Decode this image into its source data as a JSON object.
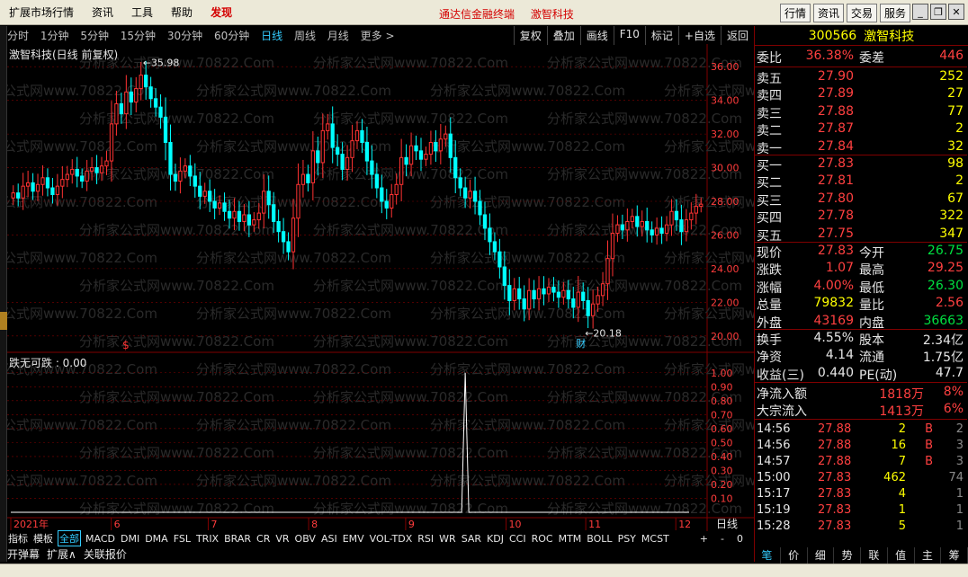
{
  "topbar": {
    "menu": [
      "扩展市场行情",
      "资讯",
      "工具",
      "帮助",
      "发现"
    ],
    "center": [
      "通达信金融终端",
      "激智科技"
    ],
    "right_buttons": [
      "行情",
      "资讯",
      "交易",
      "服务"
    ]
  },
  "periodbar": {
    "periods": [
      "分时",
      "1分钟",
      "5分钟",
      "15分钟",
      "30分钟",
      "60分钟",
      "日线",
      "周线",
      "月线",
      "更多 >"
    ],
    "active": "日线",
    "tools": [
      "复权",
      "叠加",
      "画线",
      "F10",
      "标记",
      "+自选",
      "返回"
    ]
  },
  "chart": {
    "title": "激智科技(日线 前复权)",
    "max_label": "35.98",
    "min_label": "20.18",
    "cai_marker": "财",
    "s_marker": "$",
    "indicator_title": "跌无可跌 : 0.00",
    "watermark": "分析家公式网www.70822.Com",
    "date_labels": [
      "2021年",
      "6",
      "7",
      "8",
      "9",
      "10",
      "11",
      "12"
    ],
    "period_box": "日线",
    "scroll_controls": [
      "+",
      "-",
      "0"
    ]
  },
  "chart_data": {
    "type": "candlestick",
    "title": "激智科技(日线 前复权)",
    "y_ticks_price": [
      20.0,
      22.0,
      24.0,
      26.0,
      28.0,
      30.0,
      32.0,
      34.0,
      36.0
    ],
    "price_ylim": [
      19.4,
      36.6
    ],
    "y_ticks_indicator": [
      0.1,
      0.2,
      0.3,
      0.4,
      0.5,
      0.6,
      0.7,
      0.8,
      0.9,
      1.0
    ],
    "indicator_ylim": [
      0,
      1.05
    ],
    "x_labels": [
      "2021年",
      "6",
      "7",
      "8",
      "9",
      "10",
      "11",
      "12"
    ],
    "closes": [
      28.5,
      28.2,
      28.9,
      29.1,
      28.6,
      29.0,
      29.4,
      28.8,
      28.4,
      28.9,
      29.3,
      29.6,
      29.9,
      29.5,
      29.2,
      29.8,
      30.0,
      29.7,
      30.1,
      30.4,
      32.6,
      33.8,
      33.2,
      34.5,
      33.9,
      34.7,
      35.5,
      34.8,
      34.1,
      33.6,
      33.0,
      31.5,
      29.6,
      29.2,
      29.8,
      30.1,
      29.5,
      28.9,
      28.3,
      28.6,
      28.0,
      27.6,
      27.9,
      27.4,
      27.0,
      27.4,
      26.8,
      27.2,
      26.6,
      26.9,
      27.3,
      28.6,
      27.8,
      26.8,
      26.2,
      25.6,
      25.0,
      27.0,
      29.0,
      29.6,
      29.1,
      31.0,
      30.3,
      32.2,
      32.6,
      31.2,
      30.8,
      29.9,
      30.6,
      31.6,
      32.2,
      31.5,
      30.4,
      29.6,
      28.8,
      28.0,
      27.6,
      28.4,
      29.0,
      30.6,
      30.2,
      31.3,
      31.0,
      30.5,
      30.8,
      31.5,
      31.0,
      31.7,
      32.0,
      30.6,
      29.4,
      28.8,
      28.2,
      28.6,
      28.0,
      27.2,
      26.4,
      25.6,
      25.0,
      24.1,
      23.0,
      22.1,
      22.8,
      22.2,
      21.6,
      22.7,
      22.2,
      22.8,
      22.5,
      22.9,
      22.6,
      22.3,
      22.7,
      22.2,
      21.7,
      22.6,
      22.1,
      21.2,
      21.9,
      22.4,
      23.1,
      24.6,
      26.1,
      26.6,
      26.3,
      26.8,
      27.1,
      26.5,
      26.8,
      26.3,
      26.0,
      26.4,
      26.1,
      26.6,
      27.4,
      26.9,
      26.2,
      26.9,
      27.3,
      27.7,
      27.83
    ],
    "indicator_values": "flat at 0.00 except a single spike to 1.00 near early October",
    "indicator_spike_index": 92
  },
  "right_panel": {
    "code": "300566",
    "name": "激智科技",
    "wb_label": "委比",
    "wb_value": "36.38%",
    "wc_label": "委差",
    "wc_value": "446",
    "asks": [
      {
        "label": "卖五",
        "price": "27.90",
        "vol": "252"
      },
      {
        "label": "卖四",
        "price": "27.89",
        "vol": "27"
      },
      {
        "label": "卖三",
        "price": "27.88",
        "vol": "77"
      },
      {
        "label": "卖二",
        "price": "27.87",
        "vol": "2"
      },
      {
        "label": "卖一",
        "price": "27.84",
        "vol": "32"
      }
    ],
    "bids": [
      {
        "label": "买一",
        "price": "27.83",
        "vol": "98"
      },
      {
        "label": "买二",
        "price": "27.81",
        "vol": "2"
      },
      {
        "label": "买三",
        "price": "27.80",
        "vol": "67"
      },
      {
        "label": "买四",
        "price": "27.78",
        "vol": "322"
      },
      {
        "label": "买五",
        "price": "27.75",
        "vol": "347"
      }
    ],
    "stats": [
      {
        "l1": "现价",
        "v1": "27.83",
        "c1": "red",
        "l2": "今开",
        "v2": "26.75",
        "c2": "grn"
      },
      {
        "l1": "涨跌",
        "v1": "1.07",
        "c1": "red",
        "l2": "最高",
        "v2": "29.25",
        "c2": "red"
      },
      {
        "l1": "涨幅",
        "v1": "4.00%",
        "c1": "red",
        "l2": "最低",
        "v2": "26.30",
        "c2": "grn"
      },
      {
        "l1": "总量",
        "v1": "79832",
        "c1": "yel",
        "l2": "量比",
        "v2": "2.56",
        "c2": "red"
      },
      {
        "l1": "外盘",
        "v1": "43169",
        "c1": "red",
        "l2": "内盘",
        "v2": "36663",
        "c2": "grn"
      }
    ],
    "stats2": [
      {
        "l1": "换手",
        "v1": "4.55%",
        "c1": "wht",
        "l2": "股本",
        "v2": "2.34亿",
        "c2": "wht"
      },
      {
        "l1": "净资",
        "v1": "4.14",
        "c1": "wht",
        "l2": "流通",
        "v2": "1.75亿",
        "c2": "wht"
      },
      {
        "l1": "收益(三)",
        "v1": "0.440",
        "c1": "wht",
        "l2": "PE(动)",
        "v2": "47.7",
        "c2": "wht"
      }
    ],
    "flows": [
      {
        "label": "净流入额",
        "value": "1818万",
        "pct": "8%"
      },
      {
        "label": "大宗流入",
        "value": "1413万",
        "pct": "6%"
      }
    ],
    "ticks": [
      {
        "time": "14:56",
        "price": "27.88",
        "vol": "2",
        "bs": "B",
        "n": "2"
      },
      {
        "time": "14:56",
        "price": "27.88",
        "vol": "16",
        "bs": "B",
        "n": "3"
      },
      {
        "time": "14:57",
        "price": "27.88",
        "vol": "7",
        "bs": "B",
        "n": "3"
      },
      {
        "time": "15:00",
        "price": "27.83",
        "vol": "462",
        "bs": "",
        "n": "74"
      },
      {
        "time": "15:17",
        "price": "27.83",
        "vol": "4",
        "bs": "",
        "n": "1"
      },
      {
        "time": "15:19",
        "price": "27.83",
        "vol": "1",
        "bs": "",
        "n": "1"
      },
      {
        "time": "15:28",
        "price": "27.83",
        "vol": "5",
        "bs": "",
        "n": "1"
      }
    ],
    "tabs": [
      "笔",
      "价",
      "细",
      "势",
      "联",
      "值",
      "主",
      "筹"
    ]
  },
  "indicator_tabs": [
    "指标",
    "模板",
    "全部",
    "MACD",
    "DMI",
    "DMA",
    "FSL",
    "TRIX",
    "BRAR",
    "CR",
    "VR",
    "OBV",
    "ASI",
    "EMV",
    "VOL-TDX",
    "RSI",
    "WR",
    "SAR",
    "KDJ",
    "CCI",
    "ROC",
    "MTM",
    "BOLL",
    "PSY",
    "MCST"
  ],
  "selected_indicator_tab": "全部",
  "sub_tabs": [
    "开弹幕",
    "扩展∧",
    "关联报价"
  ],
  "colors": {
    "up": "#ff3232",
    "down": "#00ffff",
    "grid": "#800000",
    "axis_text": "#ff3c3c",
    "accent": "#33ccff",
    "panel_title": "#ffff00"
  }
}
